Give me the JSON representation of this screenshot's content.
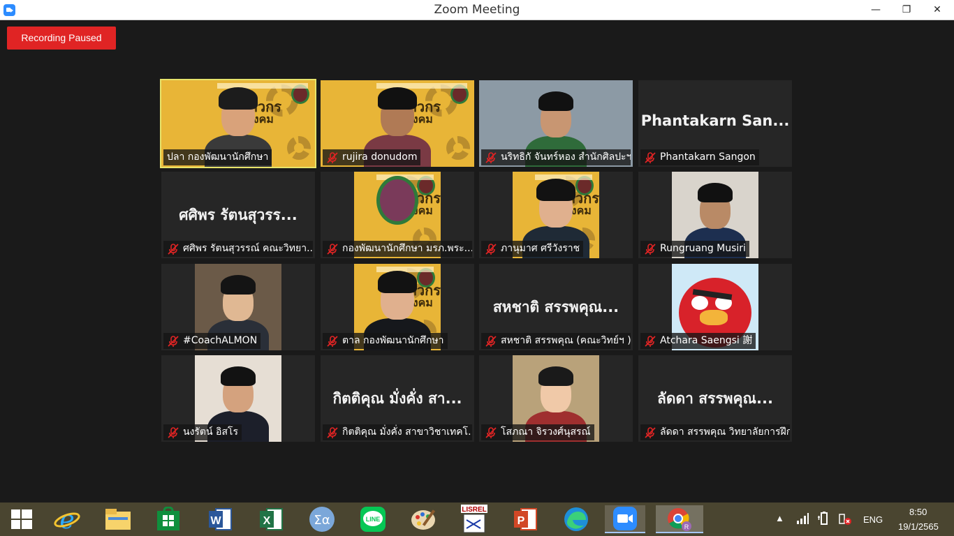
{
  "window": {
    "title": "Zoom Meeting",
    "minimize": "—",
    "maximize": "❐",
    "close": "✕"
  },
  "recording_status": "Recording Paused",
  "participants": [
    {
      "name": "ปลา กองพัฒนานักศึกษา",
      "video": true,
      "muted": false,
      "active_speaker": true
    },
    {
      "name": "rujira donudom",
      "video": true,
      "muted": true
    },
    {
      "name": "นริทธิกั จันทร์หอง สำนักศิลปะฯ",
      "video": true,
      "muted": true
    },
    {
      "name": "Phantakarn Sangon",
      "display_name": "Phantakarn San...",
      "video": false,
      "muted": true
    },
    {
      "name": "ศศิพร รัตนสุวรรณ์ คณะวิทยา...",
      "display_name": "ศศิพร รัตนสุวรร...",
      "video": false,
      "muted": true
    },
    {
      "name": "กองพัฒนานักศึกษา มรภ.พระ...",
      "video": true,
      "muted": true
    },
    {
      "name": "ภานุมาศ ศรีวังราช",
      "video": true,
      "muted": true
    },
    {
      "name": "Rungruang Musiri",
      "video": true,
      "muted": true
    },
    {
      "name": "#CoachALMON",
      "video": true,
      "muted": true
    },
    {
      "name": "ตาล กองพัฒนานักศึกษา",
      "video": true,
      "muted": true
    },
    {
      "name": "สหชาติ สรรพคุณ (คณะวิทย์ฯ )",
      "display_name": "สหชาติ สรรพคุณ...",
      "video": false,
      "muted": true
    },
    {
      "name": "Atchara Saengsi 謝",
      "video": true,
      "muted": true
    },
    {
      "name": "นงรัตน์ อิสโร",
      "video": true,
      "muted": true
    },
    {
      "name": "กิตติคุณ  มั่งคั่ง สาขาวิชาเทคโ...",
      "display_name": "กิตติคุณ  มั่งคั่ง สา...",
      "video": false,
      "muted": true
    },
    {
      "name": "โสภณา จิรวงศ์นุสรณ์",
      "video": true,
      "muted": true
    },
    {
      "name": "ลัดดา สรรพคุณ  วิทยาลัยการฝึกหั...",
      "display_name": "ลัดดา สรรพคุณ...",
      "video": false,
      "muted": true
    }
  ],
  "video_overlay": {
    "banner_line1": "วิศวกร",
    "banner_line2": "สังคม"
  },
  "taskbar": {
    "apps": [
      "start-icon",
      "internet-explorer-icon",
      "file-explorer-icon",
      "store-icon",
      "word-icon",
      "excel-icon",
      "math-input-icon",
      "line-icon",
      "paint-icon",
      "lisrel-icon",
      "powerpoint-icon",
      "edge-icon",
      "zoom-icon",
      "chrome-icon"
    ],
    "lisrel_label": "LISREL",
    "language": "ENG",
    "time": "8:50",
    "date": "19/1/2565"
  },
  "colors": {
    "recording": "#e02424",
    "active_speaker_border": "#e7e36a",
    "muted_mic": "#e02424",
    "taskbar": "#4a4530"
  }
}
